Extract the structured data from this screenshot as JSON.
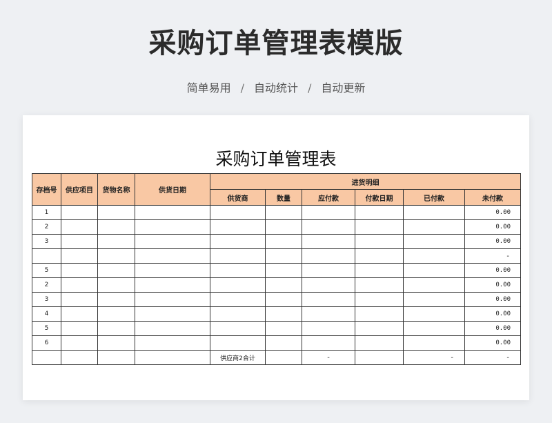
{
  "page": {
    "title": "采购订单管理表模版",
    "tags": [
      "简单易用",
      "自动统计",
      "自动更新"
    ],
    "separator": "/"
  },
  "sheet": {
    "title": "采购订单管理表",
    "headers": {
      "archive_no": "存档号",
      "supply_item": "供应项目",
      "goods_name": "货物名称",
      "supply_date": "供货日期",
      "group": "进货明细",
      "supplier": "供货商",
      "quantity": "数量",
      "payable": "应付款",
      "pay_date": "付款日期",
      "paid": "已付款",
      "unpaid": "未付款"
    },
    "rows": [
      {
        "no": "1",
        "unpaid": "0.00"
      },
      {
        "no": "2",
        "unpaid": "0.00"
      },
      {
        "no": "3",
        "unpaid": "0.00"
      },
      {
        "no": "",
        "unpaid": "-"
      },
      {
        "no": "5",
        "unpaid": "0.00"
      },
      {
        "no": "2",
        "unpaid": "0.00"
      },
      {
        "no": "3",
        "unpaid": "0.00"
      },
      {
        "no": "4",
        "unpaid": "0.00"
      },
      {
        "no": "5",
        "unpaid": "0.00"
      },
      {
        "no": "6",
        "unpaid": "0.00"
      }
    ],
    "summary": {
      "label": "供应商2合计",
      "payable": "-",
      "paid": "-",
      "unpaid": "-"
    }
  }
}
